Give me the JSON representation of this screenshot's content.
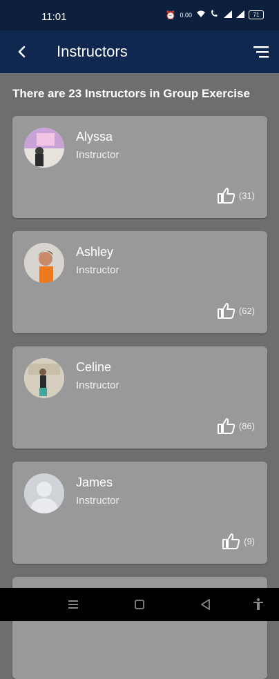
{
  "status": {
    "time": "11:01",
    "data_speed": "0.00",
    "battery": "71"
  },
  "appbar": {
    "title": "Instructors"
  },
  "summary": "There are 23 Instructors in Group Exercise",
  "instructors": [
    {
      "name": "Alyssa",
      "role": "Instructor",
      "likes": "(31)"
    },
    {
      "name": "Ashley",
      "role": "Instructor",
      "likes": "(62)"
    },
    {
      "name": "Celine",
      "role": "Instructor",
      "likes": "(86)"
    },
    {
      "name": "James",
      "role": "Instructor",
      "likes": "(9)"
    }
  ],
  "colors": {
    "statusbar": "#0c1f3d",
    "appbar": "#10284f",
    "background": "#6e6e6e",
    "card": "#999999"
  }
}
